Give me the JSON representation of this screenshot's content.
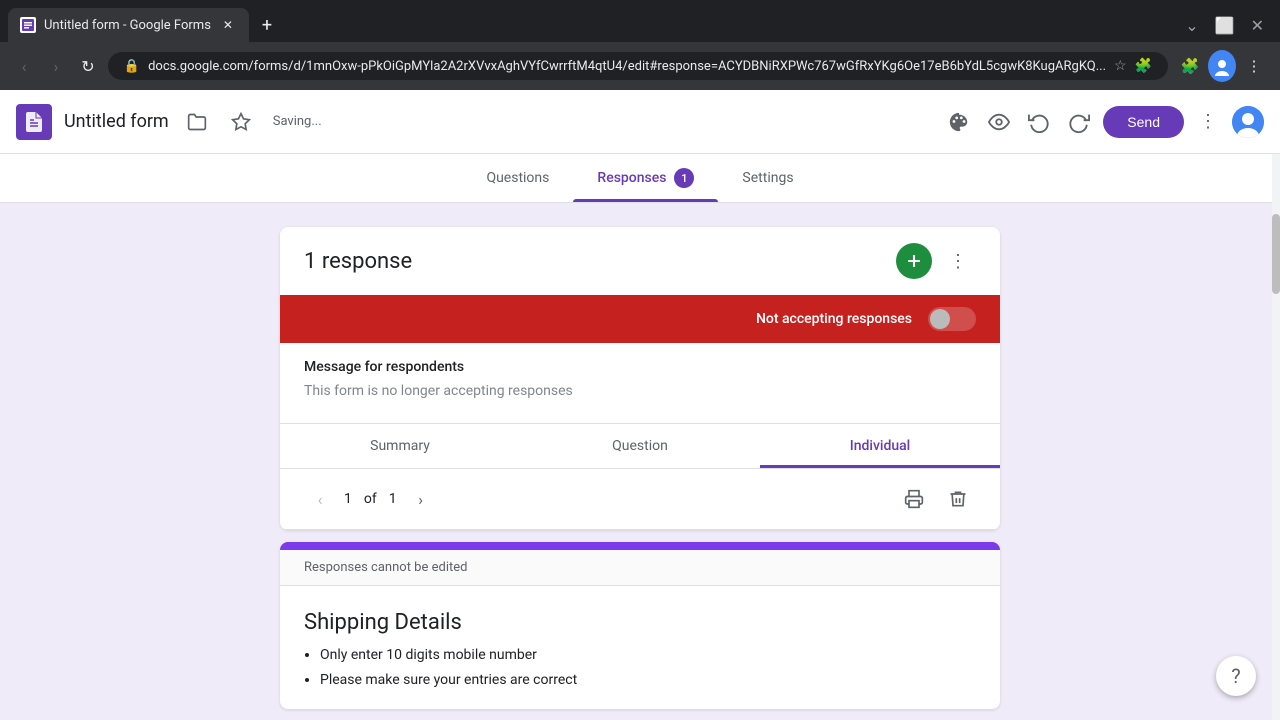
{
  "browser": {
    "tab_title": "Untitled form - Google Forms",
    "tab_favicon": "📋",
    "new_tab_icon": "+",
    "window_controls": [
      "–",
      "❐",
      "✕"
    ],
    "address": "docs.google.com/forms/d/1mnOxw-pPkOiGpMYla2A2rXVvxAghVYfCwrrftM4qtU4/edit#response=ACYDBNiRXPWc767wGfRxYKg6Oe17eB6bYdL5cgwK8KugARgKQ...",
    "nav": {
      "back": "‹",
      "forward": "›",
      "refresh": "↻"
    }
  },
  "app": {
    "logo_icon": "≡",
    "title": "Untitled form",
    "saving_text": "Saving...",
    "folder_icon": "📁",
    "star_icon": "☆",
    "header_icons": {
      "palette": "🎨",
      "preview": "👁",
      "undo": "↩",
      "redo": "↪",
      "more": "⋮",
      "send": "Send"
    }
  },
  "nav_tabs": [
    {
      "label": "Questions",
      "active": false,
      "badge": null
    },
    {
      "label": "Responses",
      "active": true,
      "badge": "1"
    },
    {
      "label": "Settings",
      "active": false,
      "badge": null
    }
  ],
  "responses_section": {
    "count_label": "1 response",
    "add_sheet_icon": "+",
    "more_icon": "⋮",
    "not_accepting_text": "Not accepting responses",
    "toggle_on": false,
    "message_label": "Message for respondents",
    "message_placeholder": "This form is no longer accepting responses"
  },
  "sub_tabs": [
    {
      "label": "Summary",
      "active": false
    },
    {
      "label": "Question",
      "active": false
    },
    {
      "label": "Individual",
      "active": true
    }
  ],
  "pagination": {
    "current": "1",
    "of_text": "of",
    "total": "1",
    "prev_icon": "‹",
    "next_icon": "›",
    "print_icon": "🖶",
    "delete_icon": "🗑"
  },
  "response_content": {
    "cannot_edit_text": "Responses cannot be edited",
    "section_title": "Shipping Details",
    "bullets": [
      "Only enter 10 digits mobile number",
      "Please make sure your entries are correct"
    ]
  },
  "help": {
    "icon": "?"
  }
}
